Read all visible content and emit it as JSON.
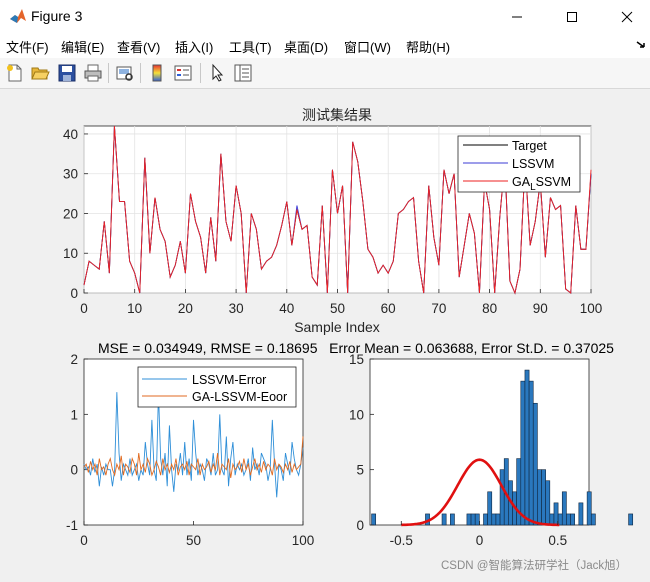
{
  "window": {
    "title": "Figure 3"
  },
  "menu": {
    "items": [
      "文件(F)",
      "编辑(E)",
      "查看(V)",
      "插入(I)",
      "工具(T)",
      "桌面(D)",
      "窗口(W)",
      "帮助(H)"
    ]
  },
  "toolbar": {
    "icons": [
      "new-figure-icon",
      "open-file-icon",
      "save-icon",
      "print-icon",
      "print-preview-icon",
      "colorbar-icon",
      "legend-icon",
      "pointer-icon",
      "property-editor-icon"
    ]
  },
  "stats_line": "MSE = 0.034949, RMSE = 0.18695   Error Mean = 0.063688, Error St.D. = 0.37025",
  "watermark": "CSDN @智能算法研学社（Jack旭）",
  "colors": {
    "target": "#000000",
    "lssvm": "#3b3bd6",
    "ga_lssvm": "#ee2222",
    "err1": "#2f8fd8",
    "err2": "#e06a20",
    "hist": "#2a78be",
    "fit": "#e01010"
  },
  "chart_data": [
    {
      "type": "line",
      "title": "测试集结果",
      "xlabel": "Sample Index",
      "ylabel": "",
      "xlim": [
        0,
        100
      ],
      "ylim": [
        0,
        42
      ],
      "xticks": [
        0,
        10,
        20,
        30,
        40,
        50,
        60,
        70,
        80,
        90,
        100
      ],
      "yticks": [
        0,
        10,
        20,
        30,
        40
      ],
      "grid": true,
      "legend_position": "top-right",
      "series": [
        {
          "name": "Target",
          "values": [
            2,
            8,
            7,
            6,
            18,
            5,
            43,
            23,
            23,
            8,
            5,
            0,
            34,
            10,
            24,
            16,
            13,
            4,
            7,
            13,
            5,
            25,
            18,
            14,
            5,
            19,
            8,
            35,
            18,
            13,
            27,
            20,
            0,
            20,
            16,
            6,
            8,
            9,
            12,
            17,
            23,
            12,
            21,
            16,
            17,
            4,
            2,
            22,
            0,
            31,
            20,
            27,
            0,
            38,
            33,
            23,
            11,
            9,
            5,
            7,
            5,
            8,
            20,
            21,
            23,
            24,
            8,
            0,
            27,
            14,
            7,
            31,
            25,
            30,
            4,
            12,
            20,
            15,
            0,
            28,
            21,
            0,
            19,
            33,
            3,
            0,
            6,
            33,
            12,
            18,
            28,
            9,
            24,
            21,
            22,
            1,
            0,
            22,
            11,
            11,
            30
          ]
        },
        {
          "name": "LSSVM",
          "values": [
            2,
            8,
            7,
            6,
            18,
            5,
            43,
            23,
            23,
            8,
            5,
            0,
            34,
            10,
            24,
            16,
            13,
            4,
            7,
            13,
            5,
            25,
            18,
            14,
            5,
            19,
            8,
            35,
            18,
            13,
            27,
            20,
            0,
            20,
            16,
            6,
            8,
            9,
            12,
            17,
            23,
            12,
            22,
            16,
            17,
            4,
            2,
            22,
            0,
            31,
            20,
            27,
            0,
            38,
            33,
            23,
            11,
            9,
            5,
            7,
            5,
            8,
            20,
            21,
            23,
            24,
            8,
            0,
            27,
            14,
            7,
            31,
            25,
            30,
            4,
            12,
            20,
            15,
            0,
            28,
            21,
            0,
            19,
            33,
            3,
            0,
            6,
            33,
            12,
            18,
            28,
            9,
            24,
            21,
            22,
            1,
            0,
            22,
            11,
            11,
            30
          ]
        },
        {
          "name": "GA_LSSVM",
          "values": [
            2,
            8,
            7,
            6,
            18,
            5,
            43,
            23,
            23,
            8,
            5,
            0,
            34,
            10,
            24,
            16,
            13,
            4,
            7,
            13,
            5,
            25,
            18,
            14,
            5,
            19,
            8,
            35,
            18,
            13,
            27,
            20,
            0,
            20,
            16,
            6,
            8,
            9,
            12,
            17,
            23,
            12,
            21,
            16,
            17,
            4,
            2,
            22,
            0,
            31,
            20,
            27,
            0,
            38,
            33,
            23,
            11,
            9,
            5,
            7,
            5,
            8,
            20,
            21,
            23,
            24,
            8,
            0,
            27,
            14,
            7,
            31,
            25,
            30,
            4,
            12,
            20,
            15,
            0,
            28,
            21,
            0,
            19,
            33,
            3,
            0,
            6,
            33,
            12,
            18,
            28,
            9,
            24,
            21,
            22,
            1,
            0,
            22,
            11,
            11,
            31
          ]
        }
      ]
    },
    {
      "type": "line",
      "xlim": [
        0,
        100
      ],
      "ylim": [
        -1,
        2
      ],
      "xticks": [
        0,
        50,
        100
      ],
      "yticks": [
        -1,
        0,
        1,
        2
      ],
      "grid": false,
      "legend_position": "top",
      "series": [
        {
          "name": "LSSVM-Error",
          "values": [
            0.1,
            0.0,
            0.05,
            -0.1,
            0.2,
            -0.05,
            0.1,
            -0.3,
            0.05,
            -0.1,
            0.1,
            0.0,
            0.0,
            -0.3,
            0.0,
            1.4,
            0.3,
            -0.2,
            0.1,
            0.0,
            -0.1,
            0.2,
            -0.1,
            0.0,
            0.1,
            -0.2,
            0.0,
            -0.1,
            0.5,
            0.1,
            -0.1,
            0.9,
            0.0,
            -0.2,
            1.4,
            0.2,
            -0.1,
            0.3,
            -0.3,
            0.8,
            0.0,
            -0.4,
            0.1,
            0.0,
            0.3,
            -0.1,
            0.5,
            -0.1,
            0.2,
            -0.2,
            0.9,
            0.3,
            -0.1,
            0.1,
            0.0,
            -0.2,
            0.2,
            0.1,
            -0.1,
            0.3,
            -0.1,
            0.0,
            1.0,
            0.0,
            -0.1,
            0.6,
            -0.3,
            0.2,
            0.5,
            -0.1,
            0.1,
            0.0,
            0.1,
            -0.1,
            0.0,
            0.2,
            -0.2,
            0.4,
            0.0,
            0.1,
            -0.1,
            0.3,
            0.2,
            0.1,
            -0.2,
            0.0,
            0.9,
            0.1,
            -0.5,
            0.1,
            0.0,
            -0.2,
            0.3,
            0.1,
            -0.1,
            0.5,
            0.2,
            0.0,
            -0.1,
            0.1,
            0.4
          ]
        },
        {
          "name": "GA-LSSVM-Eoor",
          "values": [
            0.05,
            0.1,
            -0.05,
            0.15,
            0.0,
            0.1,
            -0.1,
            0.2,
            0.0,
            0.05,
            -0.1,
            0.1,
            0.2,
            0.0,
            -0.1,
            0.1,
            0.0,
            0.25,
            -0.1,
            0.1,
            0.05,
            -0.05,
            0.2,
            0.1,
            -0.1,
            0.3,
            0.0,
            0.1,
            -0.05,
            0.2,
            0.1,
            -0.1,
            0.0,
            0.15,
            0.05,
            -0.1,
            0.2,
            0.0,
            0.1,
            -0.05,
            0.1,
            0.0,
            0.2,
            -0.1,
            0.05,
            0.1,
            0.0,
            0.15,
            -0.1,
            0.1,
            0.05,
            0.0,
            0.2,
            -0.1,
            0.1,
            0.0,
            0.05,
            0.15,
            -0.05,
            0.1,
            0.0,
            0.3,
            -0.1,
            0.1,
            0.05,
            0.0,
            0.2,
            -0.15,
            0.1,
            0.0,
            0.05,
            0.15,
            -0.05,
            0.2,
            0.0,
            0.1,
            -0.1,
            0.05,
            0.2,
            0.0,
            0.1,
            -0.05,
            0.15,
            0.0,
            0.1,
            0.05,
            -0.1,
            0.2,
            0.0,
            0.1,
            0.05,
            -0.05,
            0.1,
            0.0,
            0.15,
            -0.05,
            0.1,
            0.0,
            0.05,
            0.1,
            0.6
          ]
        }
      ]
    },
    {
      "type": "bar",
      "subtype": "histogram with normal fit",
      "xlim": [
        -0.7,
        0.7
      ],
      "ylim": [
        0,
        15
      ],
      "xticks": [
        -0.5,
        0,
        0.5
      ],
      "yticks": [
        0,
        5,
        10,
        15
      ],
      "grid": false,
      "bin_edges_start": -0.69,
      "bin_width": 0.0265,
      "counts": [
        1,
        0,
        0,
        0,
        0,
        0,
        0,
        0,
        0,
        0,
        0,
        0,
        0,
        1,
        0,
        0,
        0,
        1,
        0,
        1,
        0,
        0,
        0,
        1,
        1,
        1,
        0,
        1,
        3,
        1,
        1,
        5,
        6,
        4,
        3,
        6,
        13,
        14,
        13,
        11,
        5,
        5,
        4,
        1,
        2,
        1,
        3,
        1,
        1,
        0,
        2,
        0,
        3,
        1,
        0,
        0,
        0,
        0,
        0,
        0,
        0,
        0,
        1
      ],
      "fit": {
        "mean": 0.0,
        "std": 0.14,
        "peak": 5.9
      }
    }
  ]
}
